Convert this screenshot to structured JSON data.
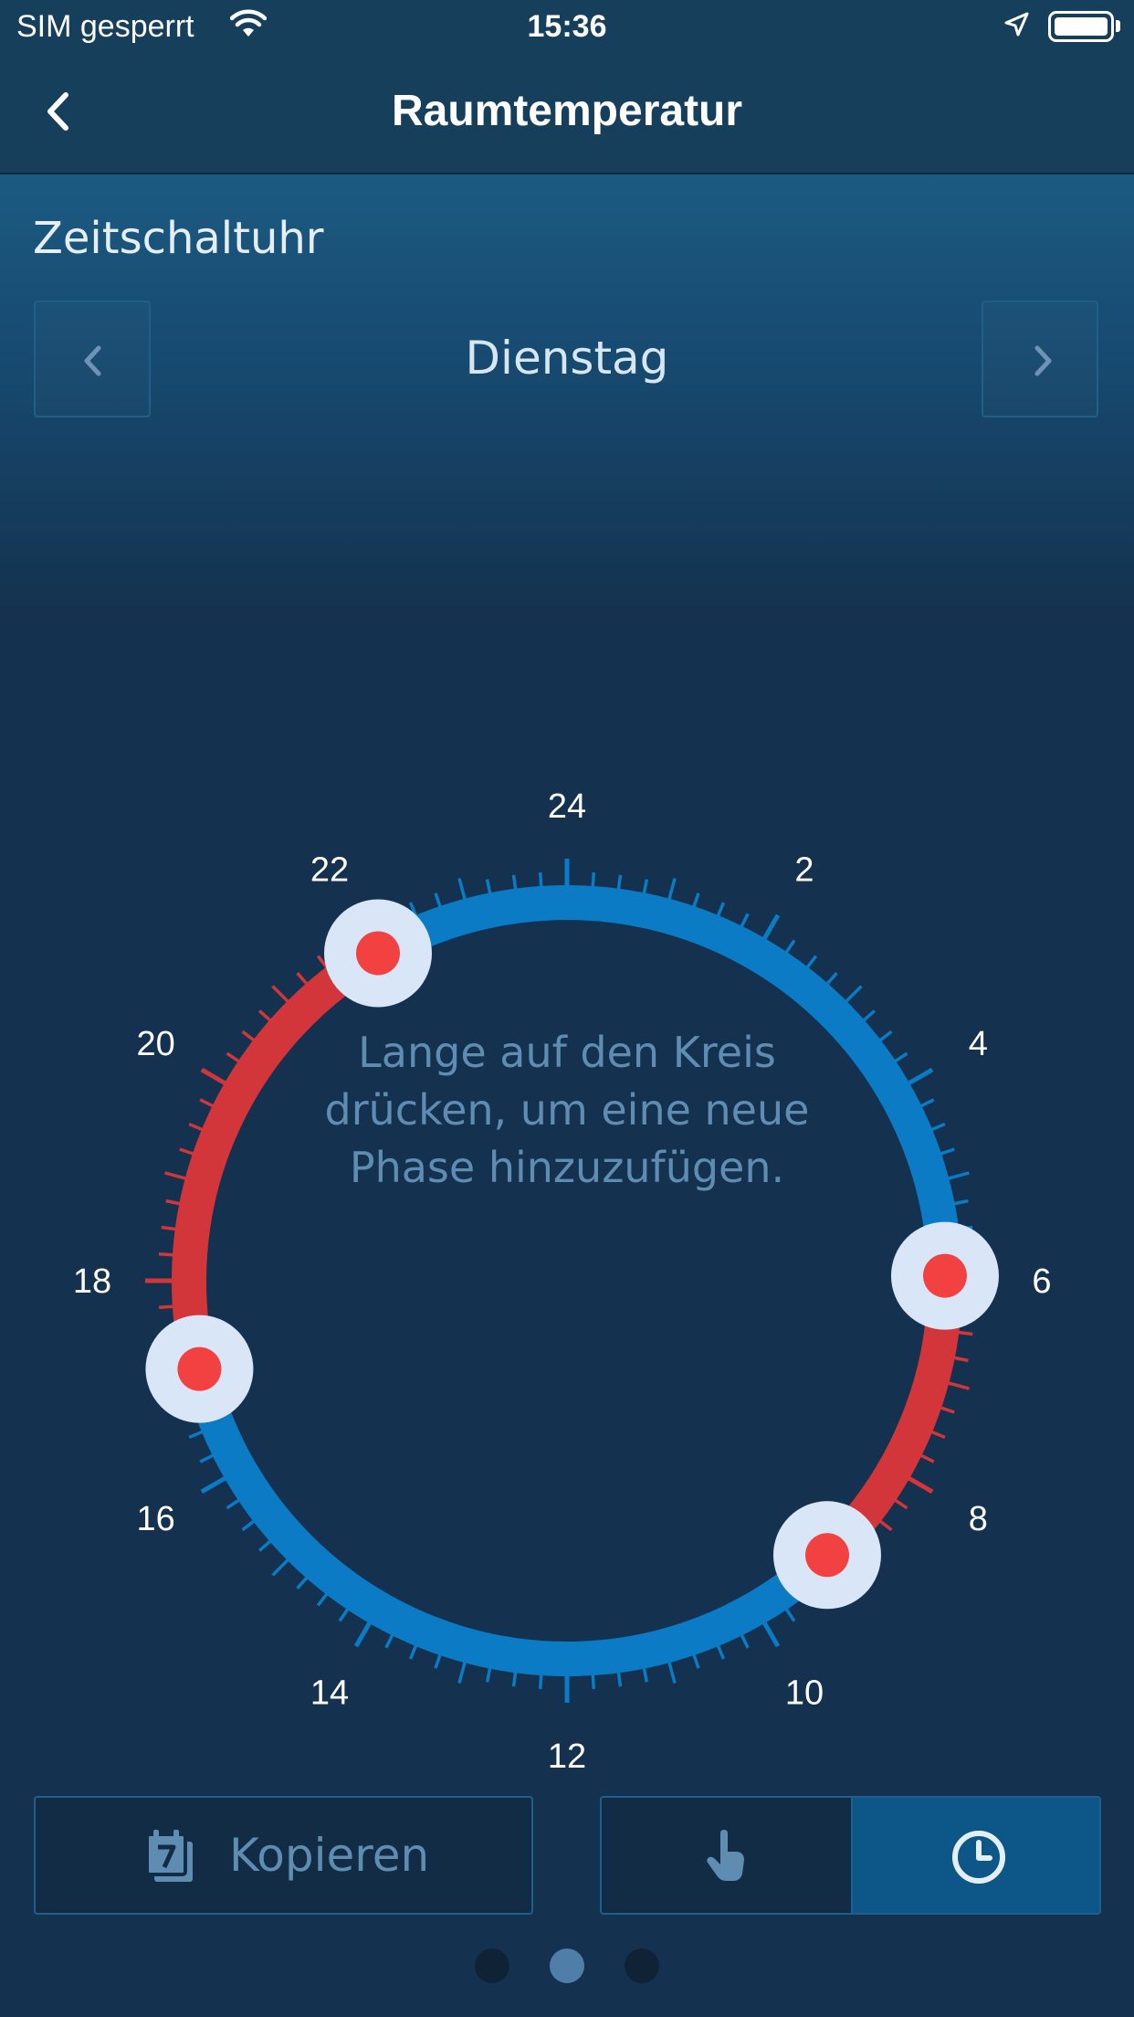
{
  "status_bar": {
    "carrier": "SIM gesperrt",
    "time": "15:36"
  },
  "nav": {
    "title": "Raumtemperatur",
    "back_icon": "chevron-left-icon"
  },
  "section": {
    "title": "Zeitschaltuhr"
  },
  "day_selector": {
    "day": "Dienstag",
    "prev_icon": "chevron-left-icon",
    "next_icon": "chevron-right-icon"
  },
  "dial": {
    "hour_labels": [
      "24",
      "2",
      "4",
      "6",
      "8",
      "10",
      "12",
      "14",
      "16",
      "18",
      "20",
      "22"
    ],
    "hint": "Lange auf den Kreis drücken, um eine neue Phase hinzuzufügen.",
    "colors": {
      "cool": "#0a7bc4",
      "warm": "#d2363a",
      "handle_fill": "#d8e6f8",
      "handle_dot": "#f24141"
    },
    "phases": [
      {
        "start_hour": 5.95,
        "end_hour": 9.1,
        "mode": "warm"
      },
      {
        "start_hour": 9.1,
        "end_hour": 17.1,
        "mode": "cool"
      },
      {
        "start_hour": 17.1,
        "end_hour": 22.0,
        "mode": "warm"
      },
      {
        "start_hour": 22.0,
        "end_hour": 5.95,
        "mode": "cool"
      }
    ],
    "handle_hours": [
      5.95,
      9.1,
      17.1,
      22.0
    ]
  },
  "actions": {
    "copy_label": "Kopieren",
    "copy_icon": "calendar-copy-icon",
    "mode_icons": [
      "hand-pointer-icon",
      "clock-icon"
    ],
    "active_mode": "clock"
  },
  "pager": {
    "count": 3,
    "active_index": 1
  }
}
